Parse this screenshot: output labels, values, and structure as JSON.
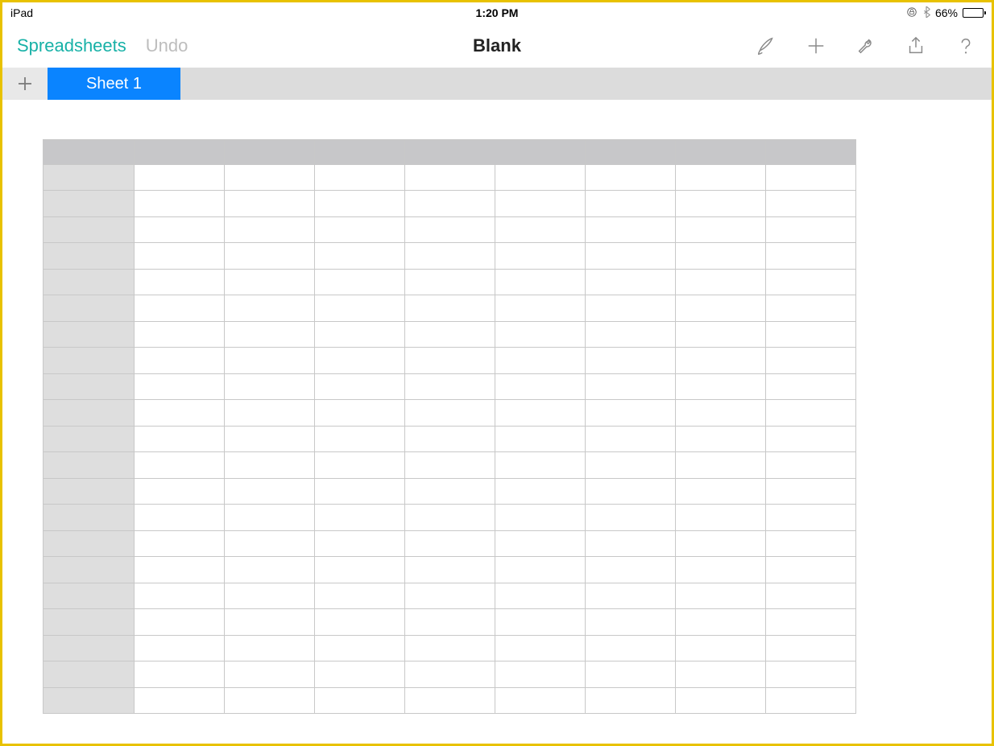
{
  "status": {
    "device": "iPad",
    "time": "1:20 PM",
    "battery_percent": "66%"
  },
  "toolbar": {
    "back_label": "Spreadsheets",
    "undo_label": "Undo",
    "document_title": "Blank"
  },
  "sheets": {
    "active_tab_label": "Sheet 1"
  },
  "grid": {
    "columns": 9,
    "rows": 21
  }
}
